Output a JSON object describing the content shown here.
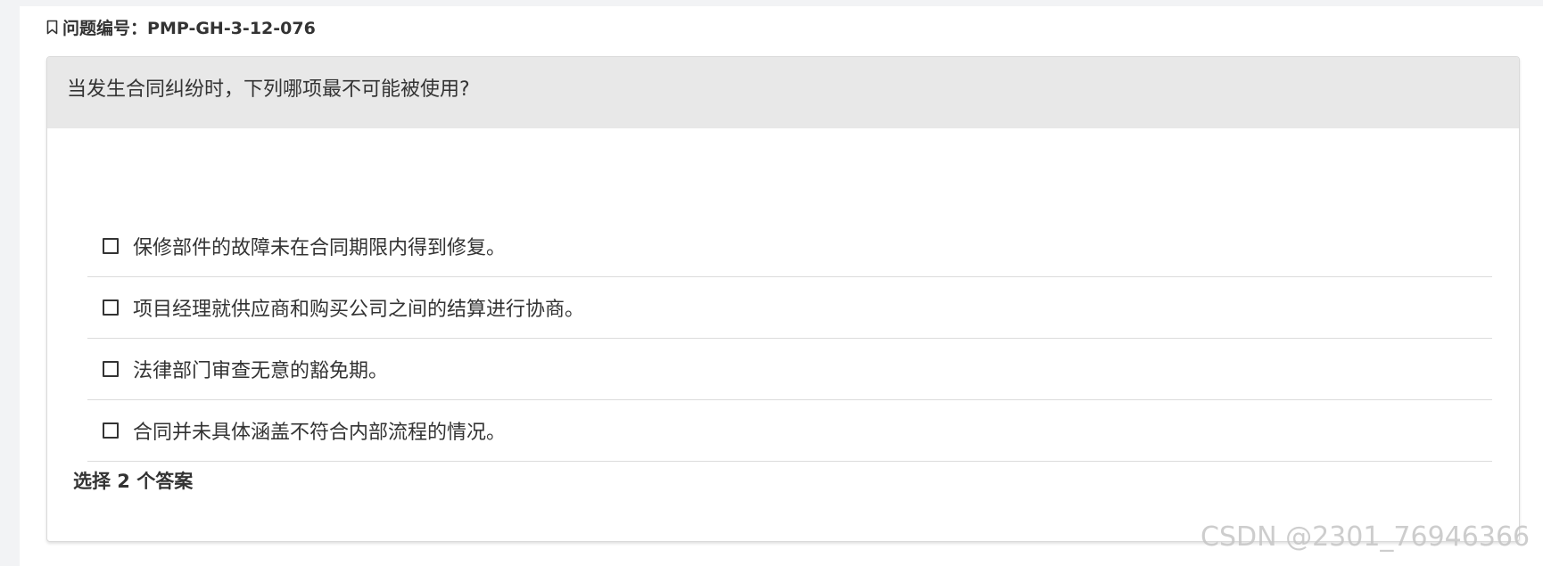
{
  "question_id": {
    "icon": "bookmark-icon",
    "label": "问题编号：",
    "value": "PMP-GH-3-12-076"
  },
  "question": {
    "text": "当发生合同纠纷时，下列哪项最不可能被使用?"
  },
  "options": [
    {
      "text": "保修部件的故障未在合同期限内得到修复。",
      "checked": false
    },
    {
      "text": "项目经理就供应商和购买公司之间的结算进行协商。",
      "checked": false
    },
    {
      "text": "法律部门审查无意的豁免期。",
      "checked": false
    },
    {
      "text": "合同并未具体涵盖不符合内部流程的情况。",
      "checked": false
    }
  ],
  "instruction": "选择 2 个答案",
  "watermark": "CSDN @2301_76946366"
}
